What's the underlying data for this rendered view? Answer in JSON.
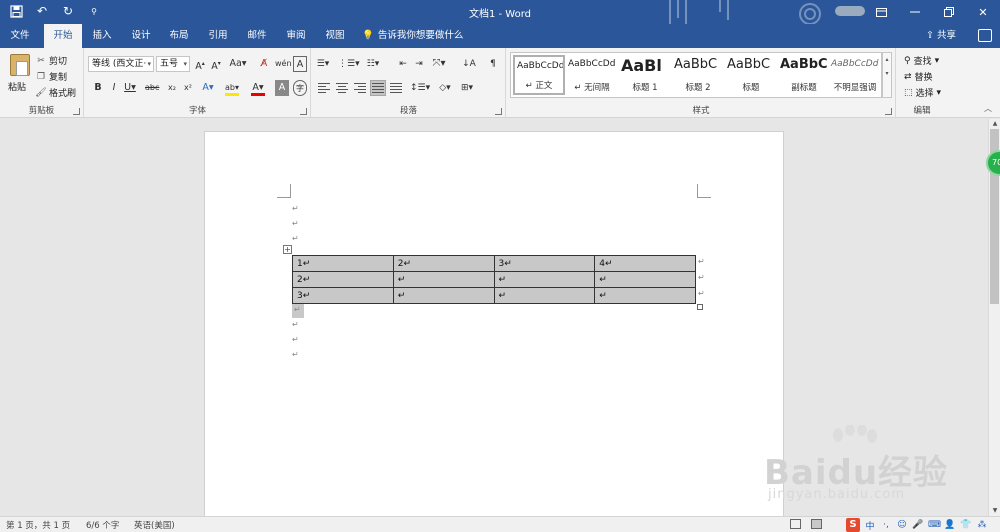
{
  "titlebar": {
    "doc_title": "文档1 - Word",
    "quick_access": [
      "save-icon",
      "undo-icon",
      "redo-icon",
      "customize-qat-icon"
    ],
    "window_buttons": [
      "ribbon-display-icon",
      "minimize-icon",
      "restore-icon",
      "close-icon"
    ]
  },
  "tabs": [
    {
      "label": "文件"
    },
    {
      "label": "开始"
    },
    {
      "label": "插入"
    },
    {
      "label": "设计"
    },
    {
      "label": "布局"
    },
    {
      "label": "引用"
    },
    {
      "label": "邮件"
    },
    {
      "label": "审阅"
    },
    {
      "label": "视图"
    }
  ],
  "active_tab": "开始",
  "tell_me": "告诉我你想要做什么",
  "share_label": "共享",
  "ribbon": {
    "clipboard": {
      "paste": "粘贴",
      "cut": "剪切",
      "copy": "复制",
      "format_painter": "格式刷",
      "label": "剪贴板"
    },
    "font": {
      "font_name": "等线 (西文正·",
      "font_size": "五号",
      "label": "字体"
    },
    "paragraph": {
      "label": "段落"
    },
    "styles": {
      "label": "样式",
      "items": [
        {
          "sample": "AaBbCcDd",
          "name": "↵ 正文"
        },
        {
          "sample": "AaBbCcDd",
          "name": "↵ 无间隔"
        },
        {
          "sample": "AaBl",
          "name": "标题 1"
        },
        {
          "sample": "AaBbC",
          "name": "标题 2"
        },
        {
          "sample": "AaBbC",
          "name": "标题"
        },
        {
          "sample": "AaBbC",
          "name": "副标题"
        },
        {
          "sample": "AaBbCcDd",
          "name": "不明显强调"
        }
      ]
    },
    "editing": {
      "find": "查找",
      "replace": "替换",
      "select": "选择",
      "label": "编辑"
    }
  },
  "document": {
    "table": [
      [
        "1↵",
        "2↵",
        "3↵",
        "4↵"
      ],
      [
        "2↵",
        "↵",
        "↵",
        "↵"
      ],
      [
        "3↵",
        "↵",
        "↵",
        "↵"
      ]
    ],
    "paragraph_mark": "↵",
    "row_end_mark": "↵",
    "table_handle": "+"
  },
  "floating_badge": "70",
  "status": {
    "page": "第 1 页，共 1 页",
    "words": "6/6 个字",
    "language": "英语(美国)"
  },
  "ime": {
    "logo": "S",
    "mode": "中"
  },
  "watermark": {
    "brand": "Baidu经验",
    "url": "jingyan.baidu.com"
  }
}
